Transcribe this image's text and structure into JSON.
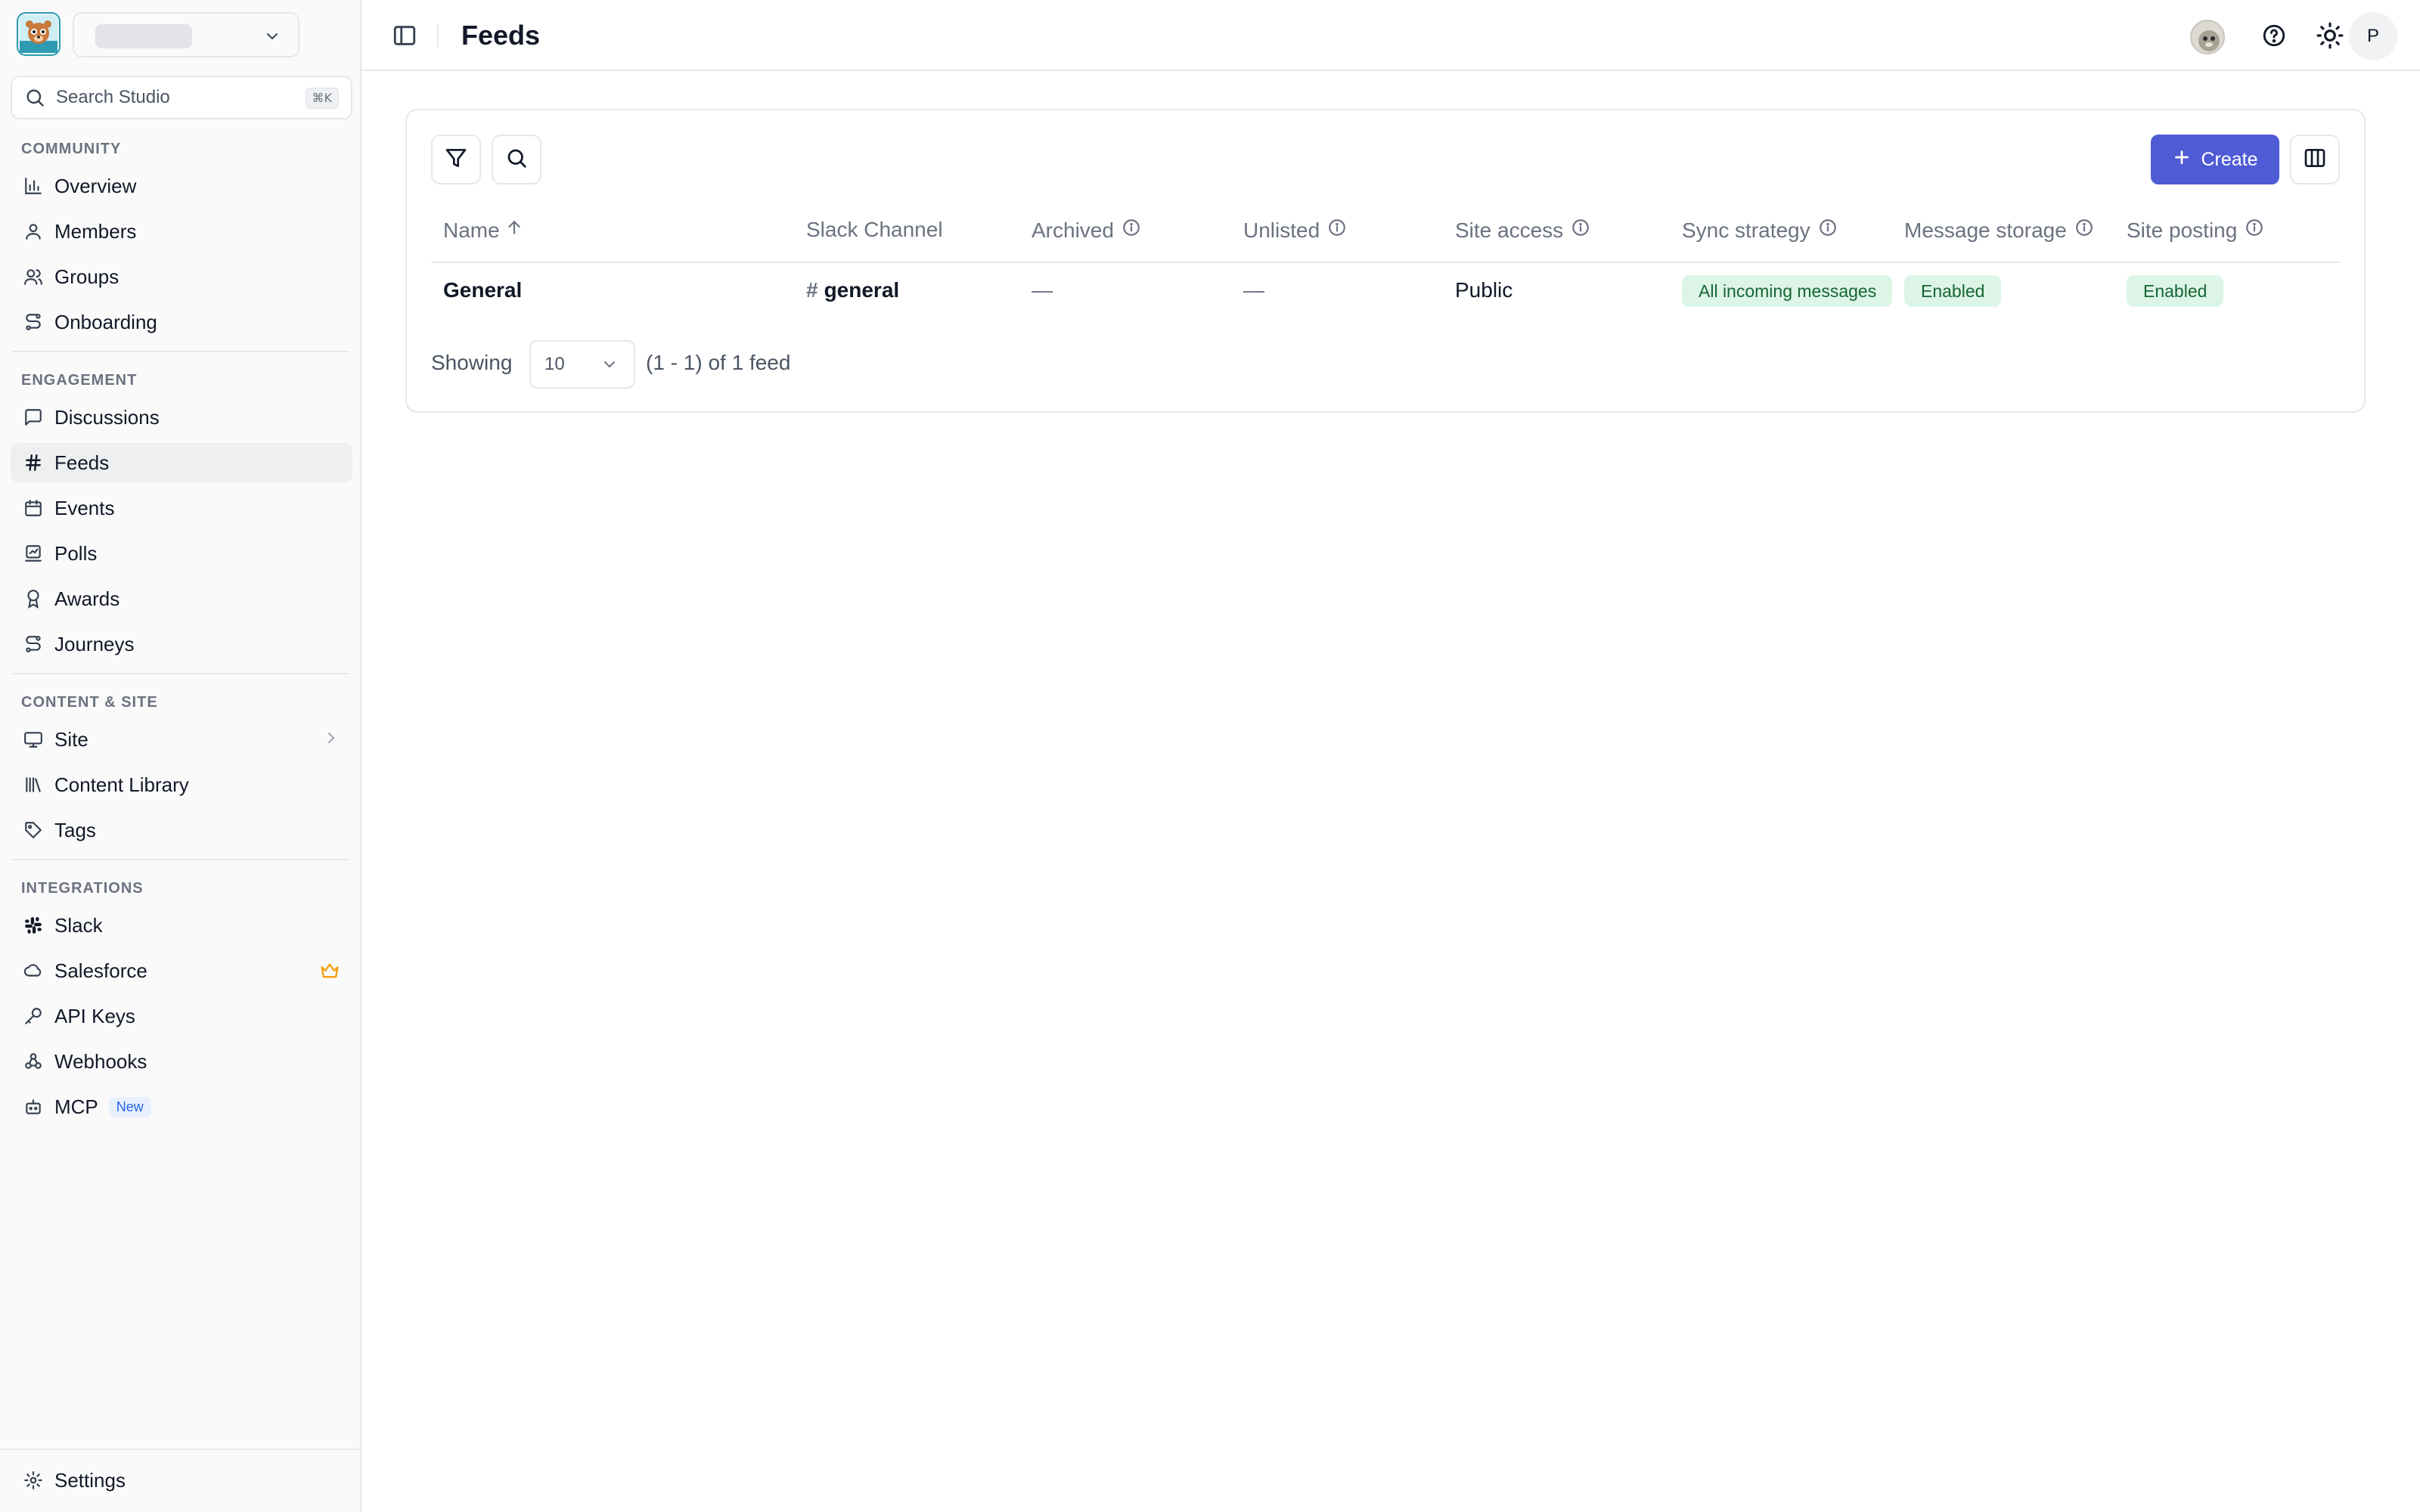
{
  "sidebar": {
    "search_placeholder": "Search Studio",
    "search_shortcut": "⌘K",
    "sections": {
      "community": "COMMUNITY",
      "engagement": "ENGAGEMENT",
      "content_site": "CONTENT & SITE",
      "integrations": "INTEGRATIONS"
    },
    "items": {
      "overview": "Overview",
      "members": "Members",
      "groups": "Groups",
      "onboarding": "Onboarding",
      "discussions": "Discussions",
      "feeds": "Feeds",
      "events": "Events",
      "polls": "Polls",
      "awards": "Awards",
      "journeys": "Journeys",
      "site": "Site",
      "content_library": "Content Library",
      "tags": "Tags",
      "slack": "Slack",
      "salesforce": "Salesforce",
      "api_keys": "API Keys",
      "webhooks": "Webhooks",
      "mcp": "MCP",
      "mcp_badge": "New",
      "settings": "Settings"
    },
    "active_item": "Feeds"
  },
  "header": {
    "title": "Feeds",
    "user_initial": "P"
  },
  "toolbar": {
    "create_label": "Create"
  },
  "table": {
    "columns": {
      "name": "Name",
      "slack_channel": "Slack Channel",
      "archived": "Archived",
      "unlisted": "Unlisted",
      "site_access": "Site access",
      "sync_strategy": "Sync strategy",
      "message_storage": "Message storage",
      "site_posting": "Site posting"
    },
    "rows": [
      {
        "name": "General",
        "slack_channel_prefix": "#",
        "slack_channel": "general",
        "archived": "—",
        "unlisted": "—",
        "site_access": "Public",
        "sync_strategy": "All incoming messages",
        "message_storage": "Enabled",
        "site_posting": "Enabled"
      }
    ]
  },
  "pagination": {
    "showing_label": "Showing",
    "page_size": "10",
    "range_text": "(1 - 1) of 1 feed"
  },
  "colors": {
    "accent": "#4f5bd5",
    "pill_bg": "#dcf5e6",
    "pill_text": "#166534",
    "crown": "#f59e0b",
    "new_badge": "#2563eb"
  }
}
